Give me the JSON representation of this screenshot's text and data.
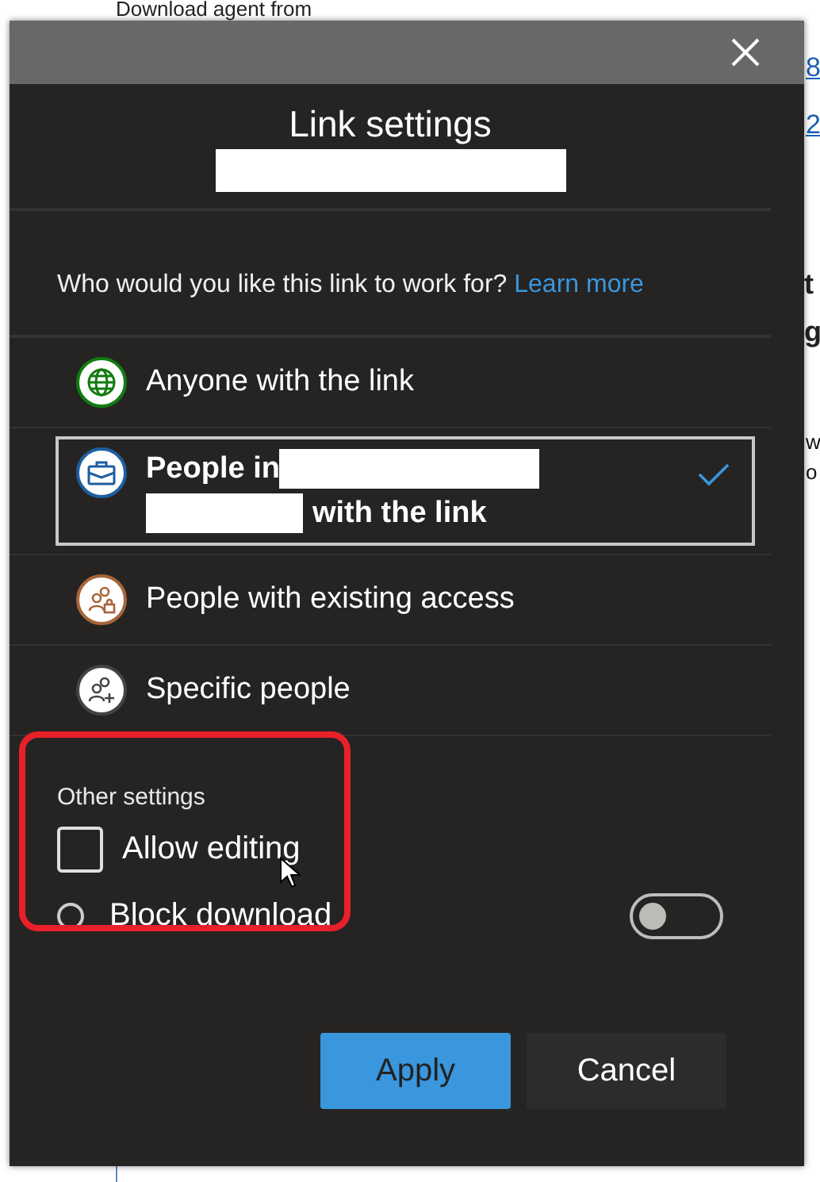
{
  "background": {
    "heading": "Download agent from",
    "fragments": [
      {
        "text": "8",
        "kind": "link"
      },
      {
        "text": "2",
        "kind": "link"
      },
      {
        "text": "t",
        "kind": "bold"
      },
      {
        "text": "g",
        "kind": "bold"
      },
      {
        "text": "w",
        "kind": "plain"
      },
      {
        "text": "o",
        "kind": "plain"
      }
    ]
  },
  "dialog": {
    "title": "Link settings",
    "question": "Who would you like this link to work for?",
    "learn_more": "Learn more",
    "options": [
      {
        "label": "Anyone with the link",
        "kind": "anyone",
        "color": "#107c10",
        "selected": false
      },
      {
        "label": "People in",
        "label_tail": "with the link",
        "redacted": true,
        "kind": "organization",
        "color": "#1d5fa0",
        "selected": true
      },
      {
        "label": "People with existing access",
        "kind": "existing",
        "color": "#a8643a",
        "selected": false
      },
      {
        "label": "Specific people",
        "kind": "specific",
        "color": "#444444",
        "selected": false
      }
    ],
    "other_settings": {
      "title": "Other settings",
      "allow_editing": {
        "label": "Allow editing",
        "checked": false
      },
      "block_download": {
        "label": "Block download",
        "on": false
      }
    },
    "buttons": [
      {
        "label": "Apply",
        "kind": "primary"
      },
      {
        "label": "Cancel",
        "kind": "secondary"
      }
    ]
  }
}
